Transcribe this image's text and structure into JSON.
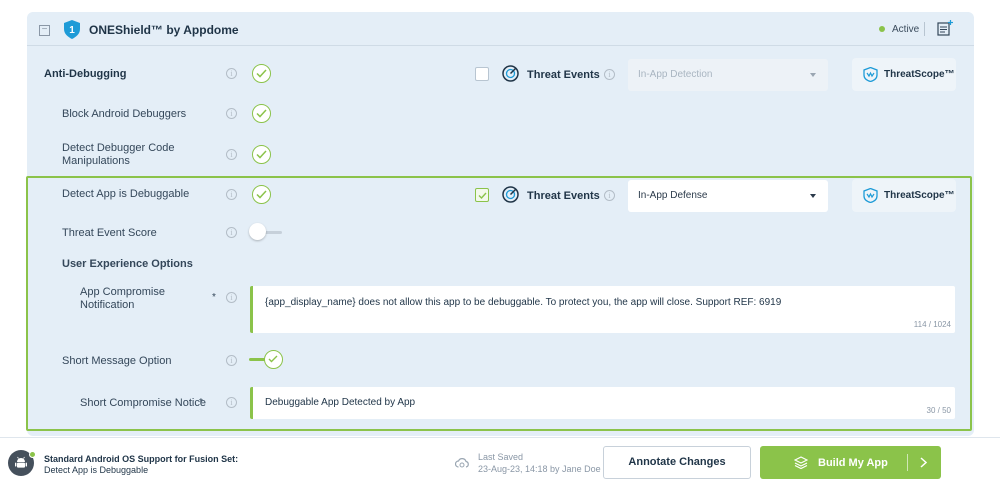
{
  "panel": {
    "index": "1",
    "title": "ONEShield™ by Appdome",
    "status": "Active",
    "collapse_glyph": "−",
    "icons": [
      "shield-icon",
      "notes-icon",
      "collapse-icon"
    ]
  },
  "rows": {
    "anti_debugging": {
      "label": "Anti-Debugging",
      "threat_events_label": "Threat Events",
      "select_value": "In-App Detection",
      "threatscope_label": "ThreatScope™"
    },
    "block_debuggers": {
      "label": "Block Android Debuggers"
    },
    "detect_manipulations": {
      "label_line1": "Detect Debugger Code",
      "label_line2": "Manipulations"
    },
    "detect_debuggable": {
      "label": "Detect App is Debuggable",
      "threat_events_label": "Threat Events",
      "select_value": "In-App Defense",
      "threatscope_label": "ThreatScope™"
    },
    "threat_event_score": {
      "label": "Threat Event Score",
      "enabled": false
    },
    "ux_options": {
      "label": "User Experience Options"
    },
    "compromise_notification": {
      "label_line1": "App Compromise",
      "label_line2": "Notification",
      "required_mark": "*",
      "value": "{app_display_name} does not allow this app to be debuggable. To protect you, the app will close. Support REF: 6919",
      "count": "114 / 1024"
    },
    "short_message": {
      "label": "Short Message Option",
      "enabled": true
    },
    "short_notice": {
      "label": "Short Compromise Notice",
      "required_mark": "*",
      "value": "Debuggable App Detected by App",
      "count": "30 / 50"
    }
  },
  "info_glyph": "i",
  "footer": {
    "title": "Standard Android OS Support for Fusion Set:",
    "subtitle": "Detect App is Debuggable",
    "saved_title": "Last Saved",
    "saved_value": "23-Aug-23, 14:18 by Jane Doe",
    "annotate_label": "Annotate Changes",
    "build_label": "Build My App"
  },
  "colors": {
    "accent": "#8bc34a",
    "panel_bg": "#e4eef7",
    "teal_icon": "#1e9bd7",
    "text_dark": "#1f3447"
  }
}
